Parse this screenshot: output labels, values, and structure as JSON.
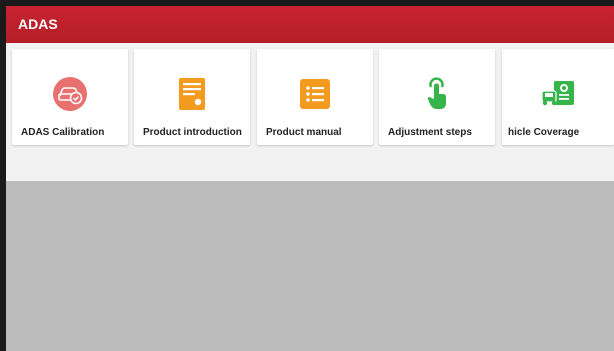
{
  "header": {
    "title": "ADAS"
  },
  "tiles": [
    {
      "label": "ADAS Calibration",
      "icon": "car-calibration-icon",
      "color": "#e8706f"
    },
    {
      "label": "Product introduction",
      "icon": "document-icon",
      "color": "#f39a1f"
    },
    {
      "label": "Product manual",
      "icon": "list-icon",
      "color": "#f39a1f"
    },
    {
      "label": "Adjustment steps",
      "icon": "tap-hand-icon",
      "color": "#35b44a"
    },
    {
      "label": "hicle Coverage",
      "icon": "vehicle-coverage-icon",
      "color": "#35b44a"
    }
  ],
  "colors": {
    "header": "#c4222e",
    "background": "#f2f2f2",
    "lower_area": "#bcbcbc"
  }
}
